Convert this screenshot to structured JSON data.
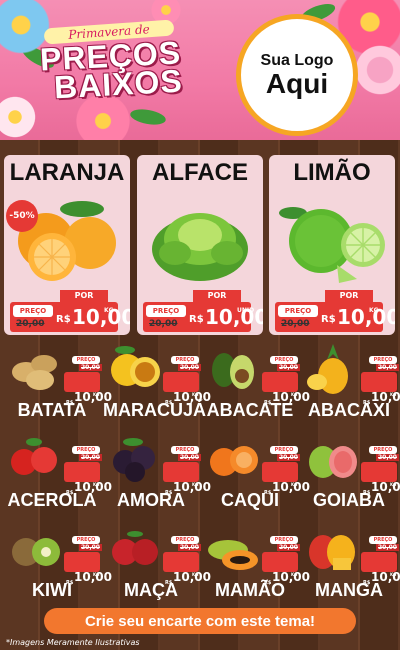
{
  "header": {
    "tagline": "Primavera de",
    "title_line1": "PREÇOS",
    "title_line2": "BAIXOS"
  },
  "logo": {
    "line1": "Sua Logo",
    "line2": "Aqui"
  },
  "featured": [
    {
      "name": "LARANJA",
      "discount": "-50%",
      "por_label": "POR",
      "preco_label": "PREÇO",
      "old_price": "20,00",
      "currency": "R$",
      "price": "10,00",
      "unit": "KG"
    },
    {
      "name": "ALFACE",
      "por_label": "POR",
      "preco_label": "PREÇO",
      "old_price": "20,00",
      "currency": "R$",
      "price": "10,00",
      "unit": "UNID"
    },
    {
      "name": "LIMÃO",
      "por_label": "POR",
      "preco_label": "PREÇO",
      "old_price": "20,00",
      "currency": "R$",
      "price": "10,00",
      "unit": "KG"
    }
  ],
  "products": [
    {
      "name": "BATATA",
      "preco_label": "PREÇO",
      "old_price": "20,00",
      "por_label": "POR",
      "currency": "R$",
      "price": "10,00",
      "unit": "KG",
      "icon": "potato-icon"
    },
    {
      "name": "MARACUJÁ",
      "preco_label": "PREÇO",
      "old_price": "20,00",
      "por_label": "POR",
      "currency": "R$",
      "price": "10,00",
      "unit": "KG",
      "icon": "passionfruit-icon"
    },
    {
      "name": "ABACATE",
      "preco_label": "PREÇO",
      "old_price": "20,00",
      "por_label": "POR",
      "currency": "R$",
      "price": "10,00",
      "unit": "KG",
      "icon": "avocado-icon"
    },
    {
      "name": "ABACAXI",
      "preco_label": "PREÇO",
      "old_price": "20,00",
      "por_label": "POR",
      "currency": "R$",
      "price": "10,00",
      "unit": "KG",
      "icon": "pineapple-icon"
    },
    {
      "name": "ACEROLA",
      "preco_label": "PREÇO",
      "old_price": "20,00",
      "por_label": "POR",
      "currency": "R$",
      "price": "10,00",
      "unit": "KG",
      "icon": "acerola-icon"
    },
    {
      "name": "AMORA",
      "preco_label": "PREÇO",
      "old_price": "20,00",
      "por_label": "POR",
      "currency": "R$",
      "price": "10,00",
      "unit": "KG",
      "icon": "blackberry-icon"
    },
    {
      "name": "CAQUI",
      "preco_label": "PREÇO",
      "old_price": "20,00",
      "por_label": "POR",
      "currency": "R$",
      "price": "10,00",
      "unit": "KG",
      "icon": "persimmon-icon"
    },
    {
      "name": "GOIABA",
      "preco_label": "PREÇO",
      "old_price": "20,00",
      "por_label": "POR",
      "currency": "R$",
      "price": "10,00",
      "unit": "KG",
      "icon": "guava-icon"
    },
    {
      "name": "KIWI",
      "preco_label": "PREÇO",
      "old_price": "20,00",
      "por_label": "POR",
      "currency": "R$",
      "price": "10,00",
      "unit": "KG",
      "icon": "kiwi-icon"
    },
    {
      "name": "MAÇA",
      "preco_label": "PREÇO",
      "old_price": "20,00",
      "por_label": "POR",
      "currency": "R$",
      "price": "10,00",
      "unit": "KG",
      "icon": "apple-icon"
    },
    {
      "name": "MAMÃO",
      "preco_label": "PREÇO",
      "old_price": "20,00",
      "por_label": "POR",
      "currency": "R$",
      "price": "10,00",
      "unit": "KG",
      "icon": "papaya-icon"
    },
    {
      "name": "MANGA",
      "preco_label": "PREÇO",
      "old_price": "20,00",
      "por_label": "POR",
      "currency": "R$",
      "price": "10,00",
      "unit": "KG",
      "icon": "mango-icon"
    }
  ],
  "footer": {
    "cta": "Crie seu encarte com este tema!",
    "note": "*Imagens Meramente Ilustrativas"
  },
  "colors": {
    "header_pink": "#f27aa6",
    "price_red": "#e53935",
    "cta_orange": "#f2772e",
    "wood_brown": "#5b3622",
    "card_pink": "#f4d6db"
  }
}
